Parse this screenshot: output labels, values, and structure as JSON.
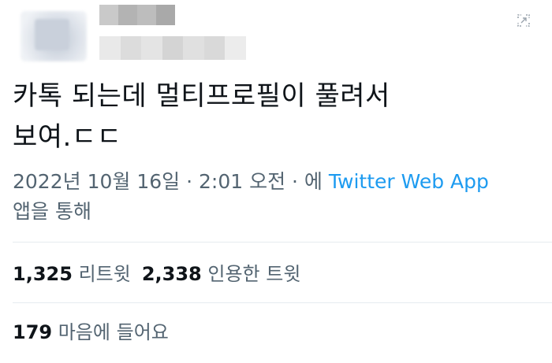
{
  "tweet": {
    "text_line1": "카톡 되는데 멀티프로필이 풀려서",
    "text_line2": "보여.ㄷㄷ"
  },
  "meta": {
    "date": "2022년 10월 16일",
    "separator1": " · ",
    "time": "2:01 오전",
    "separator2": " · ",
    "via_prefix": "에 ",
    "source_app": "Twitter Web App",
    "via_suffix": "앱을 통해"
  },
  "stats": {
    "retweets": {
      "count": "1,325",
      "label": "리트윗"
    },
    "quotes": {
      "count": "2,338",
      "label": "인용한 트윗"
    },
    "likes": {
      "count": "179",
      "label": "마음에 들어요"
    }
  },
  "colors": {
    "link": "#1d9bf0",
    "muted": "#536471",
    "text": "#0f1419",
    "divider": "#e6ecf0"
  },
  "icons": {
    "avatar": "avatar-image-blurred",
    "corner": "expand-icon"
  }
}
